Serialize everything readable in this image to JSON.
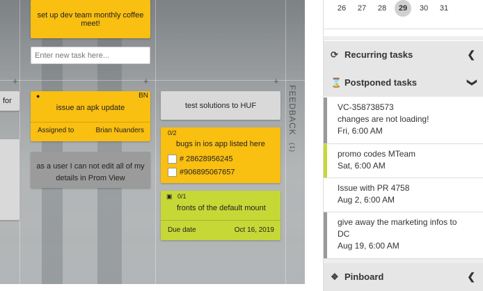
{
  "board": {
    "new_task_placeholder": "Enter new task here...",
    "feedback_label": "FEEDBACK",
    "feedback_count": "(1)",
    "partial_left_text": "for",
    "cards": {
      "coffee": "set up dev team monthly coffee meet!",
      "apk_title": "issue an apk update",
      "apk_badge": "BN",
      "apk_assigned_label": "Assigned to",
      "apk_assignee": "Brian Nuanders",
      "prom_view": "as a user I can not edit all of my details in Prom View",
      "huf": "test solutions to HUF",
      "ios_progress": "0/2",
      "ios_title": "bugs in ios app listed here",
      "ios_item1": "# 28628956245",
      "ios_item2": "#906895067657",
      "mount_progress": "0/1",
      "mount_title": "fronts of the default mount",
      "mount_due_label": "Due date",
      "mount_due": "Oct 16, 2019"
    }
  },
  "calendar": {
    "days": [
      "26",
      "27",
      "28",
      "29",
      "30",
      "31"
    ],
    "selected": "29"
  },
  "panel": {
    "recurring_label": "Recurring tasks",
    "postponed_label": "Postponed tasks",
    "pinboard_label": "Pinboard",
    "postponed": [
      {
        "line1": "VC-358738573",
        "line2": "changes are not loading!",
        "date": "Fri, 6:00 AM",
        "color": "#999999"
      },
      {
        "line1": "promo codes MTeam",
        "line2": "",
        "date": "Sat, 6:00 AM",
        "color": "#c6d836"
      },
      {
        "line1": "Issue with PR 4758",
        "line2": "",
        "date": "Aug 2, 6:00 AM",
        "color": "#ffffff"
      },
      {
        "line1": "give away the marketing infos to",
        "line2": "DC",
        "date": "Aug 19, 6:00 AM",
        "color": "#999999"
      }
    ]
  },
  "colors": {
    "yellow": "#f9bf11",
    "green": "#c6d836",
    "grey_card": "#9b9b9b"
  }
}
